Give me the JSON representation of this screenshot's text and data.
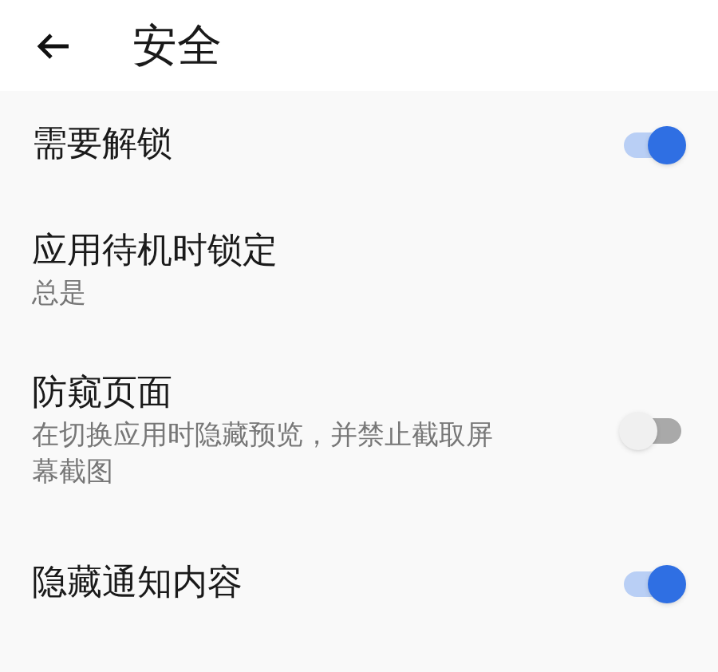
{
  "header": {
    "title": "安全"
  },
  "settings": [
    {
      "title": "需要解锁",
      "kind": "toggle",
      "on": true
    },
    {
      "title": "应用待机时锁定",
      "subtitle": "总是",
      "kind": "value"
    },
    {
      "title": "防窥页面",
      "subtitle": "在切换应用时隐藏预览，并禁止截取屏幕截图",
      "kind": "toggle",
      "on": false
    },
    {
      "title": "隐藏通知内容",
      "kind": "toggle",
      "on": true
    }
  ]
}
